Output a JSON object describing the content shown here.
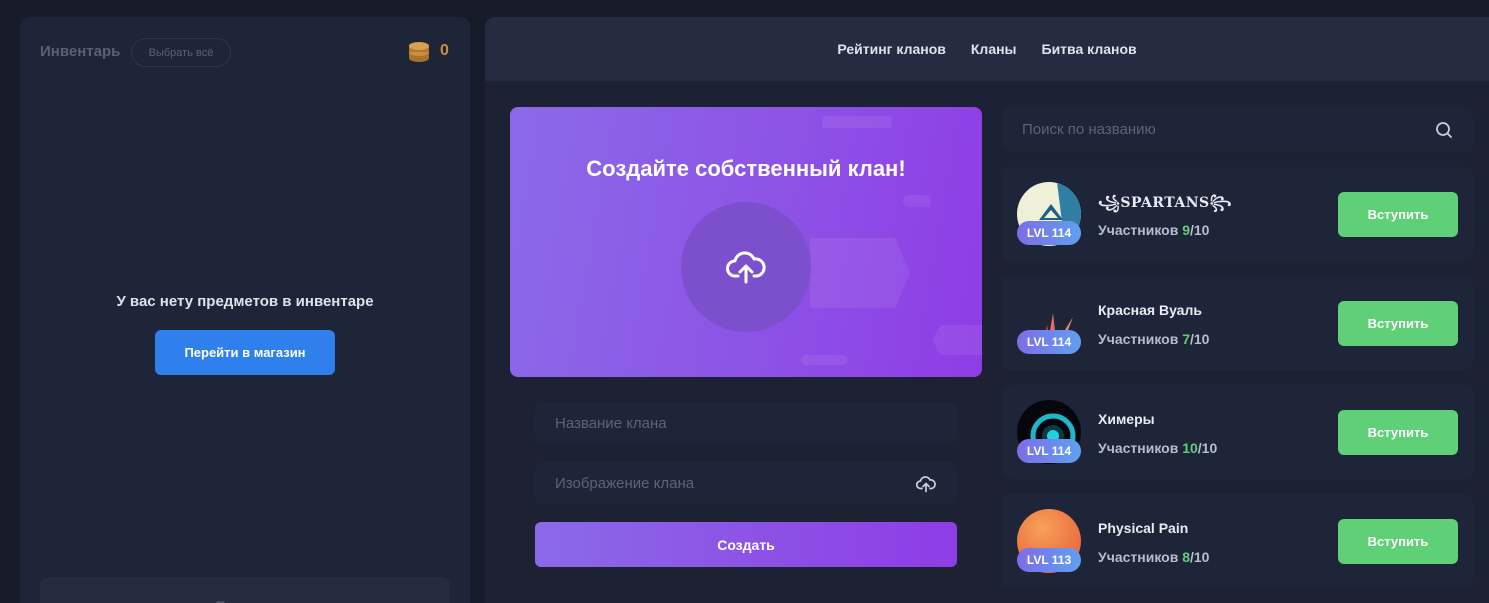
{
  "inventory": {
    "title": "Инвентарь",
    "select_all": "Выбрать всё",
    "coins": "0",
    "empty_text": "У вас нету предметов в инвентаре",
    "shop_button": "Перейти в магазин",
    "sell_button": "Продать"
  },
  "nav": {
    "items": [
      "Рейтинг кланов",
      "Кланы",
      "Битва кланов"
    ]
  },
  "create": {
    "title": "Создайте собственный клан!",
    "name_placeholder": "Название клана",
    "image_placeholder": "Изображение клана",
    "submit": "Создать"
  },
  "search": {
    "placeholder": "Поиск по названию"
  },
  "clans": [
    {
      "name": "SPARTANS",
      "name_prefix": "꧁",
      "name_suffix": "꧂",
      "level": "LVL 114",
      "members_label": "Участников",
      "members": "9",
      "max": "/10",
      "join": "Вступить"
    },
    {
      "name": "Красная Вуаль",
      "level": "LVL 114",
      "members_label": "Участников",
      "members": "7",
      "max": "/10",
      "join": "Вступить"
    },
    {
      "name": "Химеры",
      "level": "LVL 114",
      "members_label": "Участников",
      "members": "10",
      "max": "/10",
      "join": "Вступить"
    },
    {
      "name": "Physical Pain",
      "level": "LVL 113",
      "members_label": "Участников",
      "members": "8",
      "max": "/10",
      "join": "Вступить"
    }
  ],
  "colors": {
    "accent_purple": "#8d53e6",
    "accent_blue": "#2f80ed",
    "accent_green": "#5fcf78",
    "coin": "#c98f3e"
  }
}
